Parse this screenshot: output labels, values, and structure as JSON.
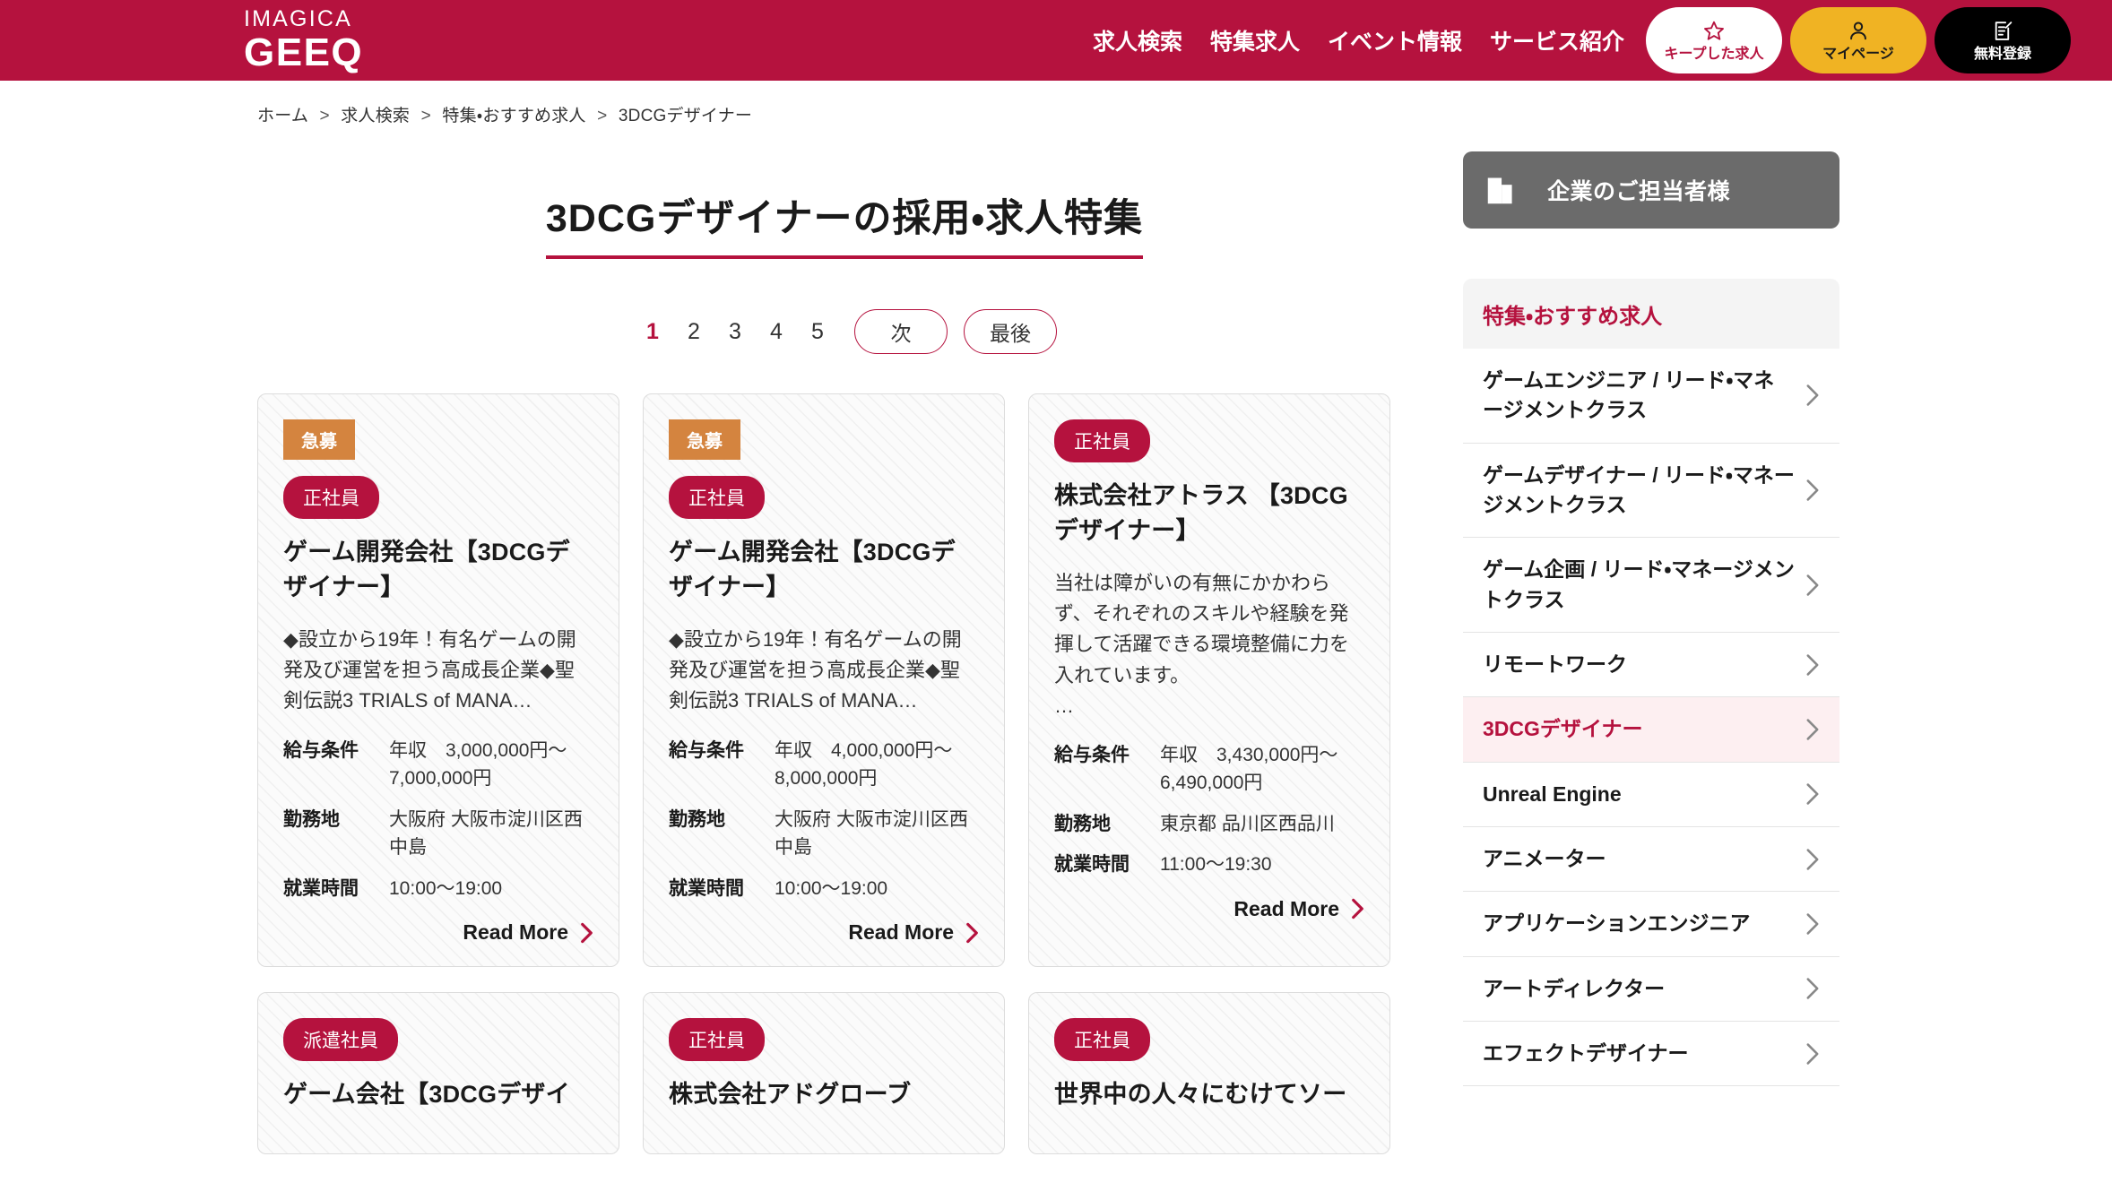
{
  "header": {
    "logo_top": "IMAGICA",
    "logo_bottom": "GEEQ",
    "nav": [
      {
        "label": "求人検索"
      },
      {
        "label": "特集求人"
      },
      {
        "label": "イベント情報"
      },
      {
        "label": "サービス紹介"
      }
    ],
    "buttons": [
      {
        "icon": "star-icon",
        "label": "キープした求人"
      },
      {
        "icon": "user-icon",
        "label": "マイページ"
      },
      {
        "icon": "document-edit-icon",
        "label": "無料登録"
      }
    ],
    "brand_color": "#b5123e",
    "accent_yellow": "#f0b323"
  },
  "breadcrumb": {
    "items": [
      "ホーム",
      "求人検索",
      "特集・おすすめ求人",
      "3DCGデザイナー"
    ],
    "separator": ">"
  },
  "main": {
    "page_title": "3DCGデザイナーの採用・求人特集",
    "pagination": {
      "pages": [
        "1",
        "2",
        "3",
        "4",
        "5"
      ],
      "active": "1",
      "next_label": "次",
      "last_label": "最後"
    },
    "labels": {
      "salary": "給与条件",
      "location": "勤務地",
      "hours": "就業時間",
      "read_more": "Read More"
    },
    "cards": [
      {
        "urgent_badge": "急募",
        "type_badge": "正社員",
        "title": "ゲーム開発会社【3DCGデザイナー】",
        "description": "◆設立から19年！有名ゲームの開発及び運営を担う高成長企業◆聖剣伝説3 TRIALS of MANA…",
        "salary": "年収　3,000,000円〜7,000,000円",
        "location": "大阪府 大阪市淀川区西中島",
        "hours": "10:00〜19:00"
      },
      {
        "urgent_badge": "急募",
        "type_badge": "正社員",
        "title": "ゲーム開発会社【3DCGデザイナー】",
        "description": "◆設立から19年！有名ゲームの開発及び運営を担う高成長企業◆聖剣伝説3 TRIALS of MANA…",
        "salary": "年収　4,000,000円〜8,000,000円",
        "location": "大阪府 大阪市淀川区西中島",
        "hours": "10:00〜19:00"
      },
      {
        "urgent_badge": "",
        "type_badge": "正社員",
        "title": "株式会社アトラス 【3DCGデザイナー】",
        "description": "当社は障がいの有無にかかわらず、それぞれのスキルや経験を発揮して活躍できる環境整備に力を入れています。\n…",
        "salary": "年収　3,430,000円〜6,490,000円",
        "location": "東京都 品川区西品川",
        "hours": "11:00〜19:30"
      }
    ],
    "cards_row2": [
      {
        "type_badge": "派遣社員",
        "title": "ゲーム会社【3DCGデザイ"
      },
      {
        "type_badge": "正社員",
        "title": "株式会社アドグローブ"
      },
      {
        "type_badge": "正社員",
        "title": "世界中の人々にむけてソー"
      }
    ]
  },
  "sidebar": {
    "corp_banner": {
      "icon": "building-icon",
      "label": "企業のご担当者様"
    },
    "panel_heading": "特集・おすすめ求人",
    "items": [
      {
        "label": "ゲームエンジニア / リード・マネージメントクラス",
        "active": false
      },
      {
        "label": "ゲームデザイナー / リード・マネージメントクラス",
        "active": false
      },
      {
        "label": "ゲーム企画 / リード・マネージメントクラス",
        "active": false
      },
      {
        "label": "リモートワーク",
        "active": false
      },
      {
        "label": "3DCGデザイナー",
        "active": true
      },
      {
        "label": "Unreal Engine",
        "active": false
      },
      {
        "label": "アニメーター",
        "active": false
      },
      {
        "label": "アプリケーションエンジニア",
        "active": false
      },
      {
        "label": "アートディレクター",
        "active": false
      },
      {
        "label": "エフェクトデザイナー",
        "active": false
      }
    ]
  }
}
